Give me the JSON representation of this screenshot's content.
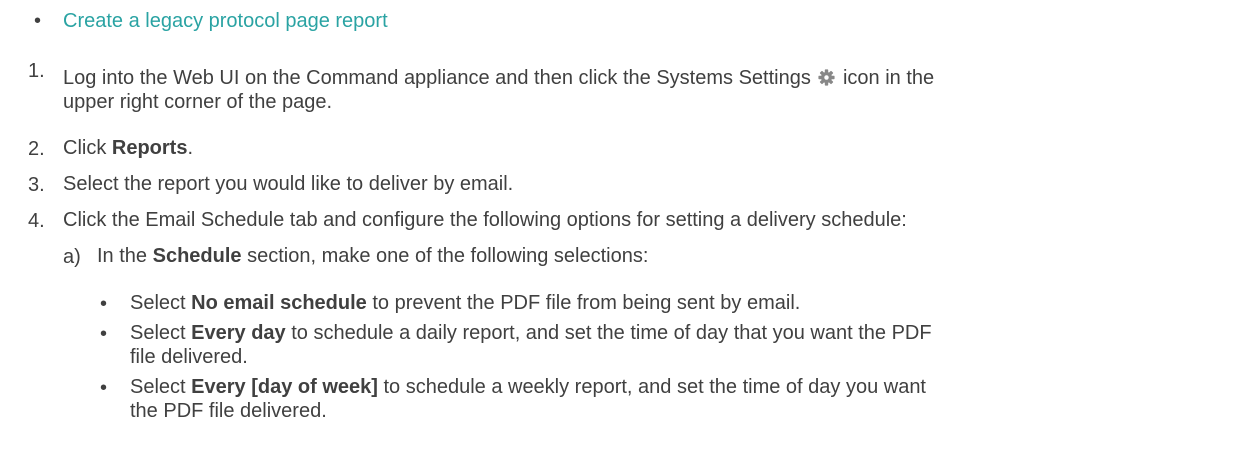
{
  "link": {
    "text": "Create a legacy protocol page report"
  },
  "steps": [
    {
      "num": "1.",
      "text_a": "Log into the Web UI on the Command appliance and then click the Systems Settings",
      "text_b": "icon in the",
      "text_c": "upper right corner of the page.",
      "icon": "gear-icon"
    },
    {
      "num": "2.",
      "pre": "Click ",
      "bold": "Reports",
      "post": "."
    },
    {
      "num": "3.",
      "text": "Select the report you would like to deliver by email."
    },
    {
      "num": "4.",
      "text": "Click the Email Schedule tab and configure the following options for setting a delivery schedule:"
    }
  ],
  "substep": {
    "letter": "a)",
    "pre": "In the ",
    "bold": "Schedule",
    "post": " section, make one of the following selections:"
  },
  "options": [
    {
      "pre": "Select ",
      "bold": "No email schedule",
      "post": " to prevent the PDF file from being sent by email.",
      "cont": ""
    },
    {
      "pre": "Select ",
      "bold": "Every day",
      "post": " to schedule a daily report, and set the time of day that you want the PDF",
      "cont": "file delivered."
    },
    {
      "pre": "Select ",
      "bold": "Every [day of week]",
      "post": " to schedule a weekly report, and set the time of day you want",
      "cont": "the PDF file delivered."
    }
  ],
  "colors": {
    "link": "#2aa3a3",
    "text": "#404040"
  }
}
